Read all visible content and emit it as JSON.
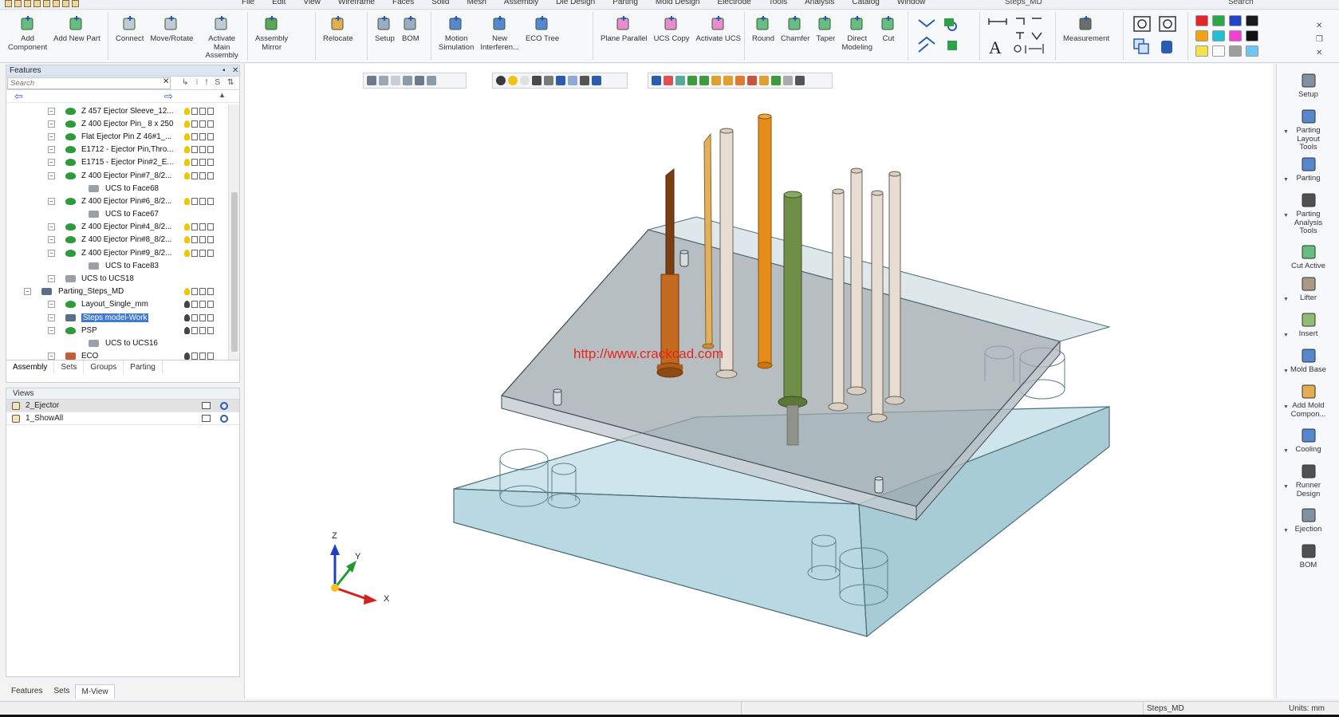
{
  "menu": [
    "File",
    "Edit",
    "View",
    "Wireframe",
    "Faces",
    "Solid",
    "Mesh",
    "Assembly",
    "Die Design",
    "Parting",
    "Mold Design",
    "Electrode",
    "Tools",
    "Analysis",
    "Catalog",
    "Window"
  ],
  "document_title": "Steps_MD",
  "search_label": "Search",
  "ribbon": {
    "assembly_group": [
      {
        "label": "Add\nComponent",
        "icon": "add-component-icon"
      },
      {
        "label": "Add New Part",
        "icon": "add-new-part-icon"
      }
    ],
    "connect_group": [
      {
        "label": "Connect",
        "icon": "connect-icon"
      },
      {
        "label": "Move/Rotate",
        "icon": "move-rotate-icon"
      },
      {
        "label": "Activate Main\nAssembly",
        "icon": "activate-main-assembly-icon"
      }
    ],
    "mirror_group": [
      {
        "label": "Assembly\nMirror",
        "icon": "assembly-mirror-icon"
      }
    ],
    "relocate_group": [
      {
        "label": "Relocate",
        "icon": "relocate-icon"
      }
    ],
    "setup_group": [
      {
        "label": "Setup",
        "icon": "setup-icon"
      },
      {
        "label": "BOM",
        "icon": "bom-icon"
      }
    ],
    "motion_group": [
      {
        "label": "Motion\nSimulation",
        "icon": "motion-simulation-icon"
      },
      {
        "label": "New\nInterferen...",
        "icon": "new-interference-icon"
      },
      {
        "label": "ECO Tree",
        "icon": "eco-tree-icon"
      }
    ],
    "ucs_group": [
      {
        "label": "Plane Parallel",
        "icon": "plane-parallel-icon"
      },
      {
        "label": "UCS Copy",
        "icon": "ucs-copy-icon"
      },
      {
        "label": "Activate UCS",
        "icon": "activate-ucs-icon"
      }
    ],
    "modeling_group": [
      {
        "label": "Round",
        "icon": "round-icon"
      },
      {
        "label": "Chamfer",
        "icon": "chamfer-icon"
      },
      {
        "label": "Taper",
        "icon": "taper-icon"
      },
      {
        "label": "Direct\nModeling",
        "icon": "direct-modeling-icon"
      },
      {
        "label": "Cut",
        "icon": "cut-icon"
      }
    ],
    "measurement_group": [
      {
        "label": "Measurement",
        "icon": "measurement-icon"
      }
    ],
    "colors": [
      "#e4262b",
      "#2aa84a",
      "#2343c7",
      "#1a1a1a",
      "#f2a30f",
      "#20c0d8",
      "#f33fd4",
      "#111111",
      "#f7e24a",
      "#ffffff",
      "#9e9e9e",
      "#6ec6f3"
    ]
  },
  "features_panel": {
    "title": "Features",
    "search_placeholder": "Search",
    "tools": [
      "↳",
      "⁝",
      "!",
      "S",
      "⇅"
    ],
    "tree": [
      {
        "label": "Z 457 Ejector Sleeve_12...",
        "indent": 2,
        "icon": "part-icon",
        "status": "light"
      },
      {
        "label": "Z 400 Ejector Pin_ 8 x 250",
        "indent": 2,
        "icon": "part-icon",
        "status": "light"
      },
      {
        "label": "Flat Ejector Pin Z 46#1_...",
        "indent": 2,
        "icon": "part-icon",
        "status": "light"
      },
      {
        "label": "E1712 - Ejector Pin,Thro...",
        "indent": 2,
        "icon": "part-icon",
        "status": "light"
      },
      {
        "label": "E1715 - Ejector Pin#2_E...",
        "indent": 2,
        "icon": "part-icon",
        "status": "light"
      },
      {
        "label": "Z 400 Ejector Pin#7_8/2...",
        "indent": 2,
        "icon": "part-icon",
        "status": "light"
      },
      {
        "label": "UCS to Face68",
        "indent": 3,
        "icon": "ucs-icon",
        "status": ""
      },
      {
        "label": "Z 400 Ejector Pin#6_8/2...",
        "indent": 2,
        "icon": "part-icon",
        "status": "light"
      },
      {
        "label": "UCS to Face67",
        "indent": 3,
        "icon": "ucs-icon",
        "status": ""
      },
      {
        "label": "Z 400 Ejector Pin#4_8/2...",
        "indent": 2,
        "icon": "part-icon",
        "status": "light"
      },
      {
        "label": "Z 400 Ejector Pin#8_8/2...",
        "indent": 2,
        "icon": "part-icon",
        "status": "light"
      },
      {
        "label": "Z 400 Ejector Pin#9_8/2...",
        "indent": 2,
        "icon": "part-icon",
        "status": "light"
      },
      {
        "label": "UCS to Face83",
        "indent": 3,
        "icon": "ucs-icon",
        "status": ""
      },
      {
        "label": "UCS to UCS18",
        "indent": 2,
        "icon": "ucs-icon",
        "status": ""
      },
      {
        "label": "Parting_Steps_MD",
        "indent": 1,
        "icon": "assembly-icon",
        "status": "light"
      },
      {
        "label": "Layout_Single_mm",
        "indent": 2,
        "icon": "part-icon",
        "status": "dark"
      },
      {
        "label": "Steps model-Work",
        "indent": 2,
        "icon": "assembly-icon",
        "status": "dark",
        "selected": true
      },
      {
        "label": "PSP",
        "indent": 2,
        "icon": "part-icon",
        "status": "dark"
      },
      {
        "label": "UCS to UCS16",
        "indent": 3,
        "icon": "ucs-icon",
        "status": ""
      },
      {
        "label": "ECO",
        "indent": 2,
        "icon": "eco-icon",
        "status": "dark"
      }
    ],
    "tabs": [
      "Assembly",
      "Sets",
      "Groups",
      "Parting"
    ]
  },
  "views_panel": {
    "title": "Views",
    "rows": [
      {
        "label": "2_Ejector",
        "selected": true
      },
      {
        "label": "1_ShowAll",
        "selected": false
      }
    ]
  },
  "bottom_tabs": [
    "Features",
    "Sets",
    "M-View"
  ],
  "viewport": {
    "watermark": "http://www.crackcad.com",
    "axis": {
      "x": "X",
      "y": "Y",
      "z": "Z"
    }
  },
  "right_toolbar": [
    {
      "label": "Setup",
      "icon": "setup-icon",
      "dropdown": false
    },
    {
      "label": "Parting\nLayout\nTools",
      "icon": "parting-layout-icon",
      "dropdown": true
    },
    {
      "label": "Parting",
      "icon": "parting-icon",
      "dropdown": true
    },
    {
      "label": "Parting\nAnalysis\nTools",
      "icon": "parting-analysis-icon",
      "dropdown": true
    },
    {
      "label": "Cut Active",
      "icon": "cut-active-icon",
      "dropdown": false
    },
    {
      "label": "Lifter",
      "icon": "lifter-icon",
      "dropdown": true
    },
    {
      "label": "Insert",
      "icon": "insert-icon",
      "dropdown": true
    },
    {
      "label": "Mold Base",
      "icon": "mold-base-icon",
      "dropdown": true
    },
    {
      "label": "Add Mold\nCompon...",
      "icon": "add-mold-component-icon",
      "dropdown": true
    },
    {
      "label": "Cooling",
      "icon": "cooling-icon",
      "dropdown": true
    },
    {
      "label": "Runner\nDesign",
      "icon": "runner-design-icon",
      "dropdown": true
    },
    {
      "label": "Ejection",
      "icon": "ejection-icon",
      "dropdown": true
    },
    {
      "label": "BOM",
      "icon": "bom-icon",
      "dropdown": false
    }
  ],
  "status": {
    "document": "Steps_MD",
    "units": "Units: mm"
  }
}
